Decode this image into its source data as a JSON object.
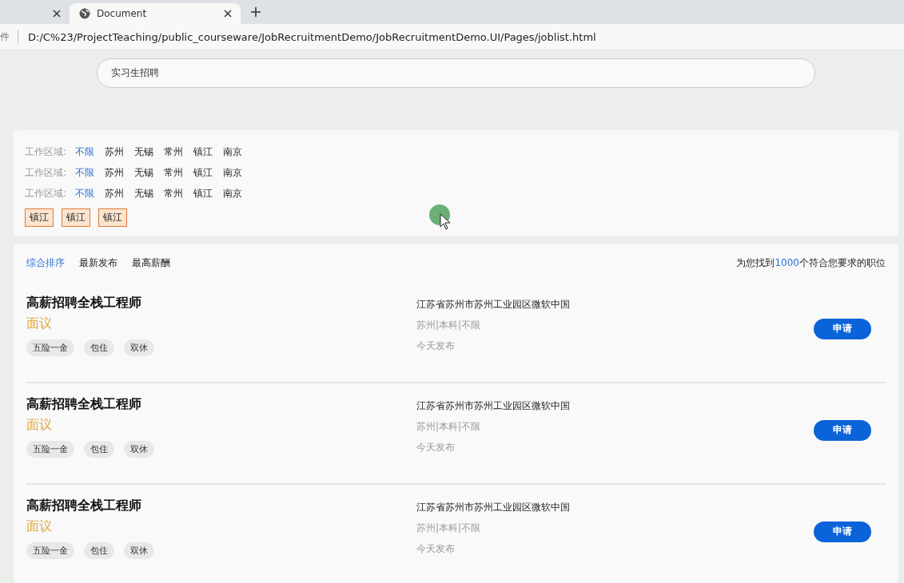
{
  "browser": {
    "tabs": [
      {
        "selected": false
      },
      {
        "title": "Document",
        "selected": true
      }
    ],
    "address_prefix": "件",
    "address": "D:/C%23/ProjectTeaching/public_courseware/JobRecruitmentDemo/JobRecruitmentDemo.UI/Pages/joblist.html"
  },
  "search": {
    "value": "实习生招聘"
  },
  "filters": [
    {
      "label": "工作区域:",
      "options": [
        {
          "label": "不限",
          "selected": true
        },
        {
          "label": "苏州",
          "selected": false
        },
        {
          "label": "无锡",
          "selected": false
        },
        {
          "label": "常州",
          "selected": false
        },
        {
          "label": "镇江",
          "selected": false
        },
        {
          "label": "南京",
          "selected": false
        }
      ]
    },
    {
      "label": "工作区域:",
      "options": [
        {
          "label": "不限",
          "selected": true
        },
        {
          "label": "苏州",
          "selected": false
        },
        {
          "label": "无锡",
          "selected": false
        },
        {
          "label": "常州",
          "selected": false
        },
        {
          "label": "镇江",
          "selected": false
        },
        {
          "label": "南京",
          "selected": false
        }
      ]
    },
    {
      "label": "工作区域:",
      "options": [
        {
          "label": "不限",
          "selected": true
        },
        {
          "label": "苏州",
          "selected": false
        },
        {
          "label": "无锡",
          "selected": false
        },
        {
          "label": "常州",
          "selected": false
        },
        {
          "label": "镇江",
          "selected": false
        },
        {
          "label": "南京",
          "selected": false
        }
      ]
    }
  ],
  "chosen_tags": [
    "镇江",
    "镇江",
    "镇江"
  ],
  "sort_tabs": [
    {
      "label": "综合排序",
      "selected": true
    },
    {
      "label": "最新发布",
      "selected": false
    },
    {
      "label": "最高薪酬",
      "selected": false
    }
  ],
  "result_count": {
    "prefix": "为您找到",
    "count": "1000",
    "suffix": "个符合您要求的职位"
  },
  "jobs": [
    {
      "title": "高薪招聘全栈工程师",
      "salary": "面议",
      "benefits": [
        "五险一金",
        "包住",
        "双休"
      ],
      "address": "江苏省苏州市苏州工业园区微软中国",
      "requirements": "苏州|本科|不限",
      "posted": "今天发布",
      "action": "申请"
    },
    {
      "title": "高薪招聘全栈工程师",
      "salary": "面议",
      "benefits": [
        "五险一金",
        "包住",
        "双休"
      ],
      "address": "江苏省苏州市苏州工业园区微软中国",
      "requirements": "苏州|本科|不限",
      "posted": "今天发布",
      "action": "申请"
    },
    {
      "title": "高薪招聘全栈工程师",
      "salary": "面议",
      "benefits": [
        "五险一金",
        "包住",
        "双休"
      ],
      "address": "江苏省苏州市苏州工业园区微软中国",
      "requirements": "苏州|本科|不限",
      "posted": "今天发布",
      "action": "申请"
    }
  ]
}
